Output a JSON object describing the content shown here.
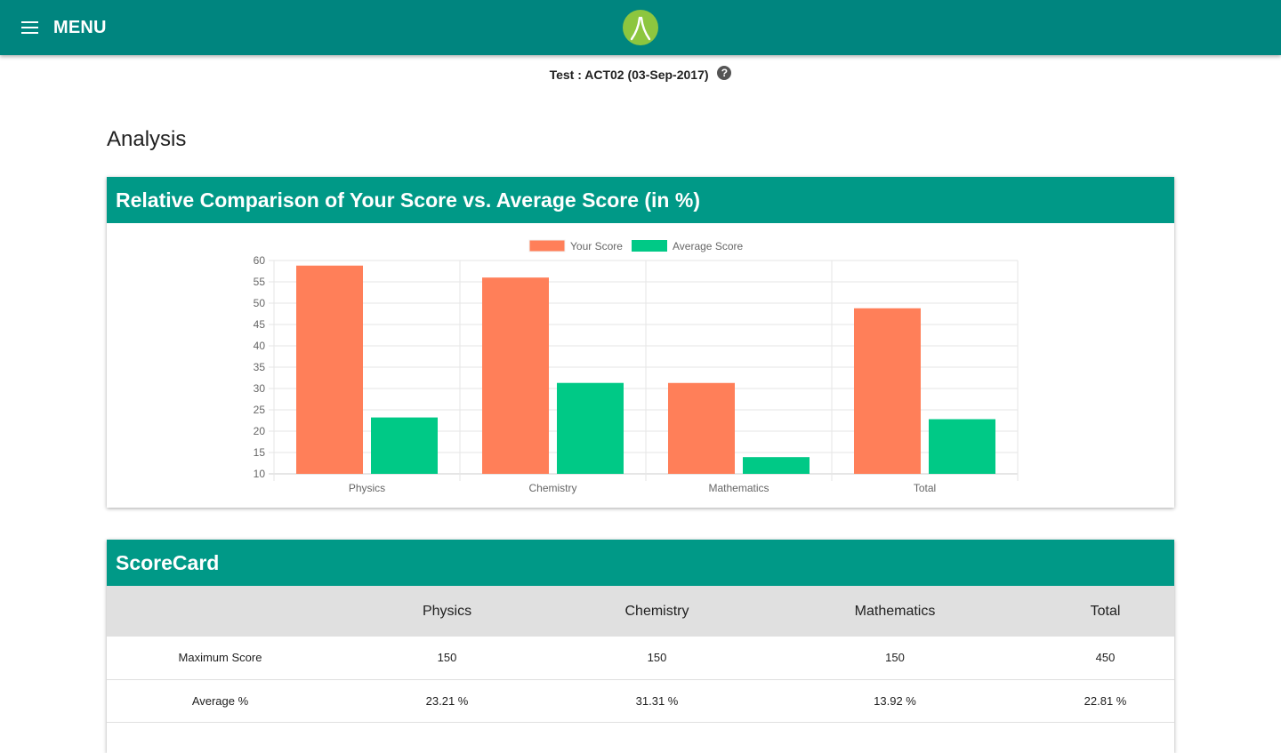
{
  "header": {
    "menu_label": "MENU"
  },
  "test_info": {
    "label": "Test : ACT02 (03-Sep-2017)",
    "help_symbol": "?"
  },
  "section_title": "Analysis",
  "comparison_card": {
    "title": "Relative Comparison of Your Score vs. Average Score (in %)"
  },
  "chart_data": {
    "type": "bar",
    "categories": [
      "Physics",
      "Chemistry",
      "Mathematics",
      "Total"
    ],
    "series": [
      {
        "name": "Your Score",
        "color": "#ff7f59",
        "values": [
          58.8,
          56.0,
          31.3,
          48.8
        ]
      },
      {
        "name": "Average Score",
        "color": "#00c986",
        "values": [
          23.21,
          31.31,
          13.92,
          22.81
        ]
      }
    ],
    "ylim": [
      10,
      60
    ],
    "yticks": [
      10,
      15,
      20,
      25,
      30,
      35,
      40,
      45,
      50,
      55,
      60
    ],
    "grid": true,
    "legend_position": "top"
  },
  "scorecard": {
    "title": "ScoreCard",
    "columns": [
      "",
      "Physics",
      "Chemistry",
      "Mathematics",
      "Total"
    ],
    "rows": [
      {
        "label": "Maximum Score",
        "values": [
          "150",
          "150",
          "150",
          "450"
        ]
      },
      {
        "label": "Average %",
        "values": [
          "23.21 %",
          "31.31 %",
          "13.92 %",
          "22.81 %"
        ]
      }
    ]
  },
  "colors": {
    "header_bg": "#00857f",
    "card_header_bg": "#009987",
    "your_score": "#ff7f59",
    "average_score": "#00c986"
  }
}
